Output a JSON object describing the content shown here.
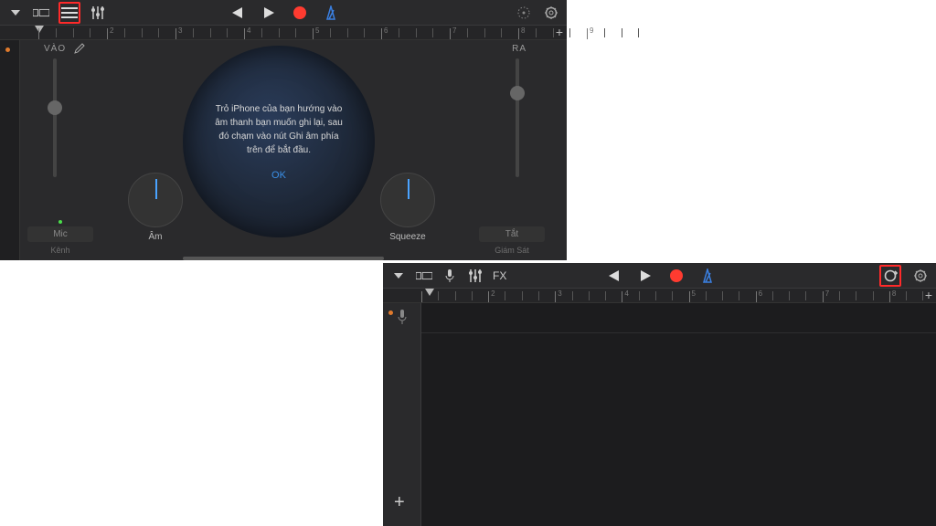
{
  "panelA": {
    "labels": {
      "in": "VÀO",
      "out": "RA",
      "tone": "Âm",
      "squeeze": "Squeeze"
    },
    "bottom": {
      "mic": {
        "button": "Mic",
        "caption": "Kênh"
      },
      "mute": {
        "button": "Tắt",
        "caption": "Giám Sát"
      }
    },
    "prompt": {
      "message": "Trỏ iPhone của bạn hướng vào âm thanh bạn muốn ghi lại, sau đó chạm vào nút Ghi âm phía trên để bắt đầu.",
      "ok": "OK"
    },
    "ruler_plus": "+"
  },
  "panelB": {
    "fx": "FX",
    "ruler_plus": "+",
    "add": "+"
  }
}
